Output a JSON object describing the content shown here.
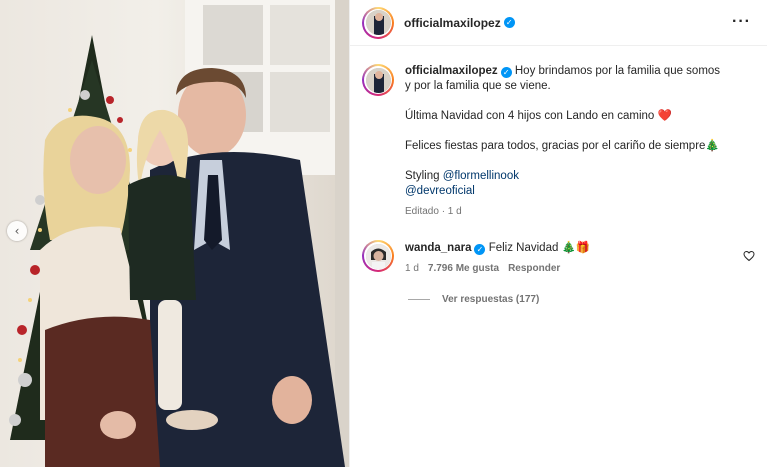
{
  "post": {
    "author": "officialmaxilopez",
    "more_icon": "more-horizontal-icon"
  },
  "caption": {
    "author": "officialmaxilopez",
    "line1": "Hoy brindamos por la familia que somos",
    "line2": "y por la familia que se viene.",
    "line3": "Última Navidad con 4 hijos con Lando en camino",
    "line3_emoji": "❤️",
    "line4": "Felices fiestas para todos, gracias por el cariño de siempre",
    "line4_emoji": "🎄",
    "styling_label": "Styling",
    "mention1": "@flormellinook",
    "mention2": "@devreoficial",
    "edited": "Editado · 1 d"
  },
  "comment": {
    "author": "wanda_nara",
    "text": "Feliz Navidad",
    "emojis": "🎄🎁",
    "age": "1 d",
    "likes": "7.796 Me gusta",
    "reply_label": "Responder",
    "view_replies": "Ver respuestas (177)"
  },
  "colors": {
    "verified": "#0095f6",
    "mention": "#00376b",
    "meta_text": "#737373",
    "heart_red": "#ed1c24"
  }
}
